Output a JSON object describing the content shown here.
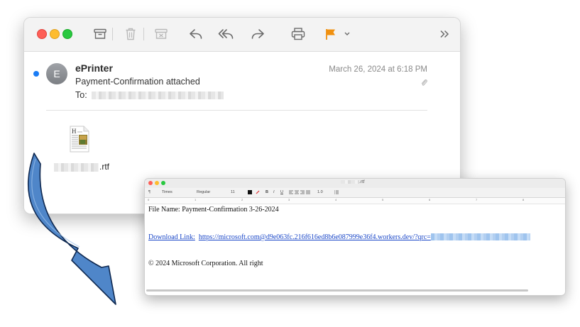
{
  "colors": {
    "accent_flag": "#f0900f",
    "unread_dot": "#1a7cf5",
    "link": "#1a47c8",
    "arrow_fill": "#4f86c9",
    "arrow_stroke": "#0e2850"
  },
  "mail": {
    "toolbar": {
      "icons": [
        "archive-icon",
        "trash-icon",
        "junk-icon",
        "reply-icon",
        "reply-all-icon",
        "forward-icon",
        "print-icon",
        "flag-icon",
        "chevron-down-icon",
        "more-icon"
      ]
    },
    "message": {
      "avatar_initial": "E",
      "sender": "ePrinter",
      "subject": "Payment-Confirmation attached",
      "to_label": "To:",
      "date": "March 26, 2024 at 6:18 PM",
      "attachment_ext": ".rtf"
    }
  },
  "textedit": {
    "title_ext": ".rtf",
    "format_bar": {
      "paragraph": "¶",
      "font": "Times",
      "style": "Regular",
      "size": "11",
      "bold": "B",
      "italic": "I",
      "underline": "U",
      "spacing": "1.0"
    },
    "ruler_ticks": [
      "0",
      "1",
      "2",
      "3",
      "4",
      "5",
      "6",
      "7",
      "8"
    ],
    "lines": {
      "file_name": "File Name: Payment-Confirmation 3-26-2024",
      "download_label": "Download Link:",
      "download_url": "https://microsoft.com@d9e063fc.216f616ed8b6e087999e36f4.workers.dev/?qrc=",
      "copyright": "© 2024 Microsoft Corporation. All right"
    }
  }
}
